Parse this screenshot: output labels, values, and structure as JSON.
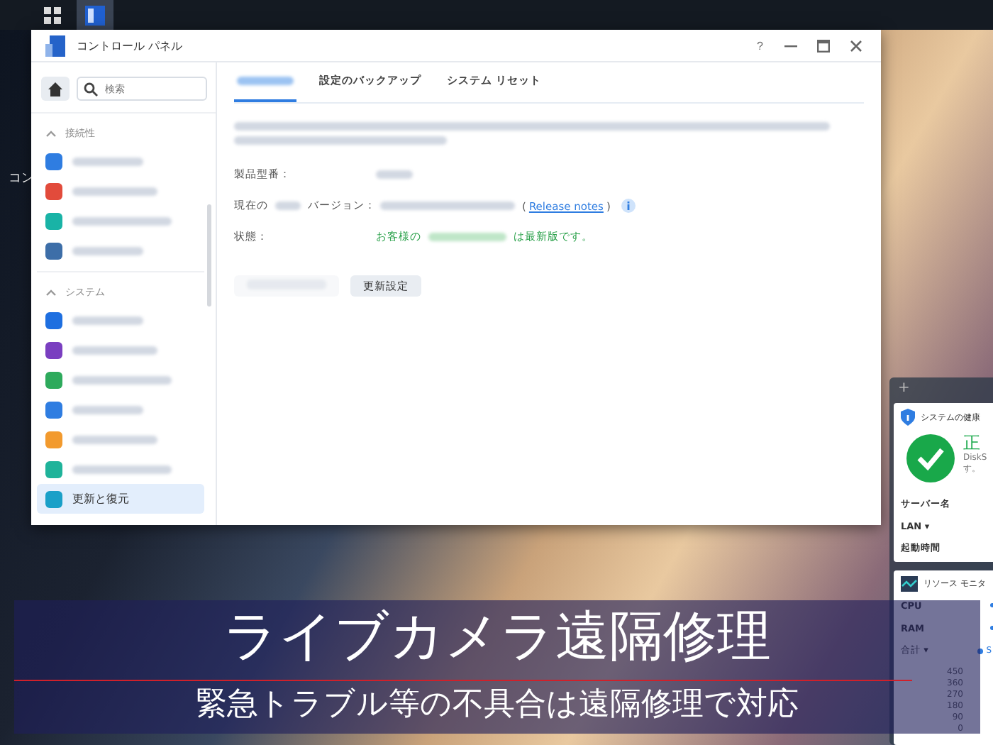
{
  "taskbar": {
    "buttons": [
      {
        "selected": false
      },
      {
        "selected": true
      }
    ]
  },
  "desktop_label": "コン",
  "window": {
    "title": "コントロール パネル",
    "help": "?"
  },
  "sidebar": {
    "search": {
      "placeholder": "検索"
    },
    "sections": [
      {
        "title": "接続性",
        "expanded": true,
        "items": [
          {
            "color": "#2f7de1",
            "selected": false
          },
          {
            "color": "#e24b3b",
            "selected": false
          },
          {
            "color": "#19b3a6",
            "selected": false
          },
          {
            "color": "#3d6ea8",
            "selected": false
          }
        ]
      },
      {
        "title": "システム",
        "expanded": true,
        "items": [
          {
            "color": "#1e6fe0",
            "selected": false
          },
          {
            "color": "#7a3fc0",
            "selected": false
          },
          {
            "color": "#2eaa5c",
            "selected": false
          },
          {
            "color": "#2f7de1",
            "selected": false
          },
          {
            "color": "#f29a2e",
            "selected": false
          },
          {
            "color": "#1fb39a",
            "selected": false
          },
          {
            "color": "#1aa0c8",
            "label": "更新と復元",
            "selected": true
          }
        ]
      }
    ]
  },
  "tabs": [
    {
      "selected": true
    },
    {
      "label": "設定のバックアップ",
      "selected": false
    },
    {
      "label": "システム リセット",
      "selected": false
    }
  ],
  "info": {
    "model_label": "製品型番：",
    "version_label_start": "現在の",
    "version_label_end": "バージョン：",
    "link_open": "(",
    "link": "Release notes",
    "link_close": ")",
    "status_label": "状態：",
    "status_start": "お客様の",
    "status_end": "は最新版です。"
  },
  "buttons": [
    {
      "disabled": true
    },
    {
      "label": "更新設定",
      "disabled": false
    }
  ],
  "widgets": {
    "add": "+",
    "health": {
      "title": "システムの健康",
      "status": "正",
      "detail_1": "DiskS",
      "detail_2": "す。",
      "rows": [
        "サーバー名",
        "LAN ▾",
        "起動時間"
      ]
    },
    "monitor": {
      "title": "リソース モニタ",
      "rows": [
        "CPU",
        "RAM"
      ],
      "total": "合計 ▾",
      "legend": "S",
      "ticks": [
        "450",
        "360",
        "270",
        "180",
        "90",
        "0"
      ]
    }
  },
  "banner": {
    "title": "ライブカメラ遠隔修理",
    "subtitle": "緊急トラブル等の不具合は遠隔修理で対応"
  }
}
